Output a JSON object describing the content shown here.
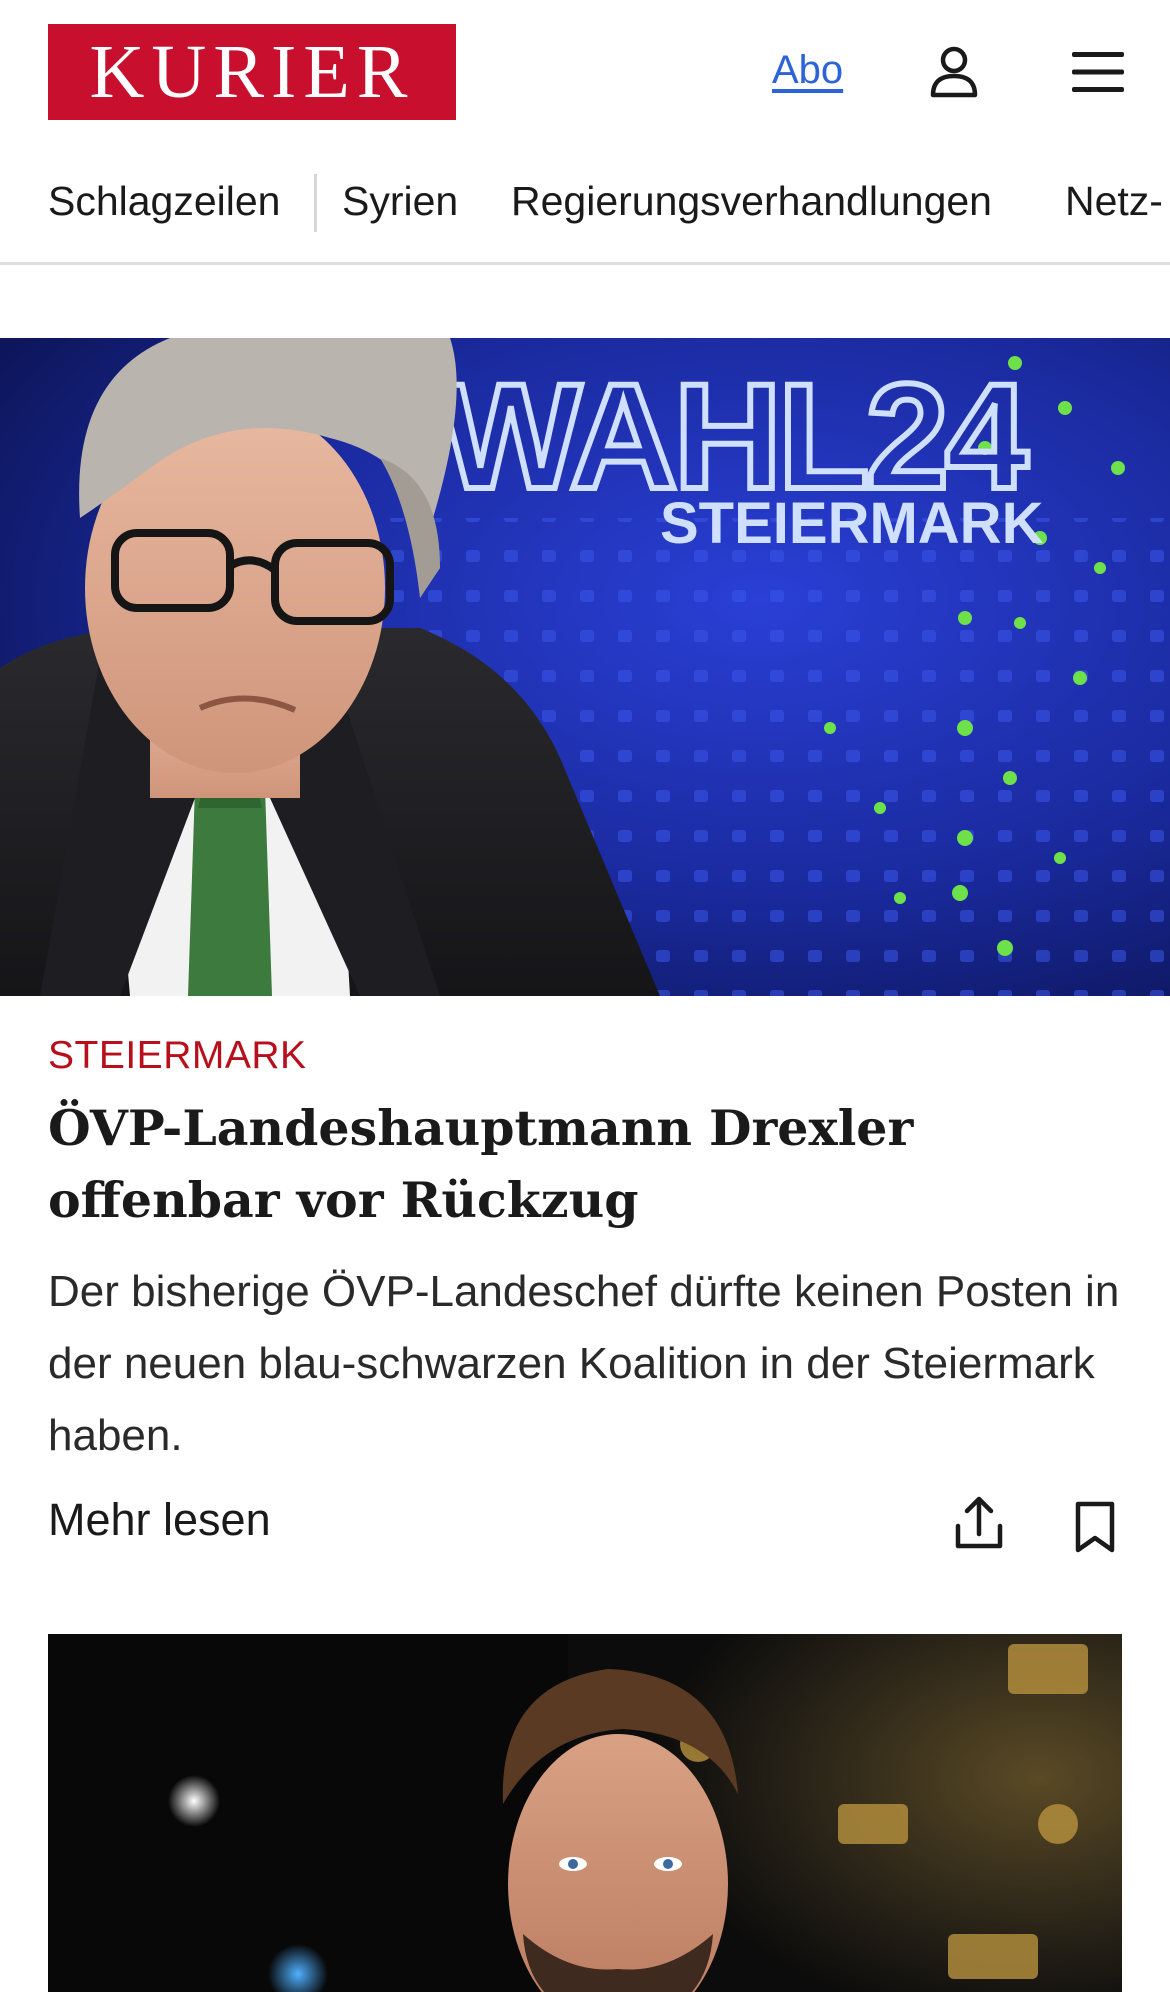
{
  "header": {
    "logo_text": "KURIER",
    "brand_color": "#c8102e",
    "abo_label": "Abo",
    "user_icon": "user-icon",
    "menu_icon": "hamburger-menu-icon"
  },
  "nav": {
    "items": [
      {
        "label": "Schlagzeilen"
      },
      {
        "label": "Syrien"
      },
      {
        "label": "Regierungsverhandlungen"
      },
      {
        "label": "Netz-"
      }
    ]
  },
  "hero": {
    "backdrop_text_main": "WAHL24",
    "backdrop_text_sub": "STEIERMARK"
  },
  "article": {
    "kicker": "STEIERMARK",
    "kicker_color": "#b7101c",
    "headline": "ÖVP-Landeshauptmann Drexler offenbar vor Rückzug",
    "teaser": "Der bisherige ÖVP-Landeschef dürfte keinen Posten in der neuen blau-schwarzen Koalition in der Steiermark haben.",
    "more_label": "Mehr lesen",
    "share_icon": "share-icon",
    "bookmark_icon": "bookmark-icon"
  }
}
